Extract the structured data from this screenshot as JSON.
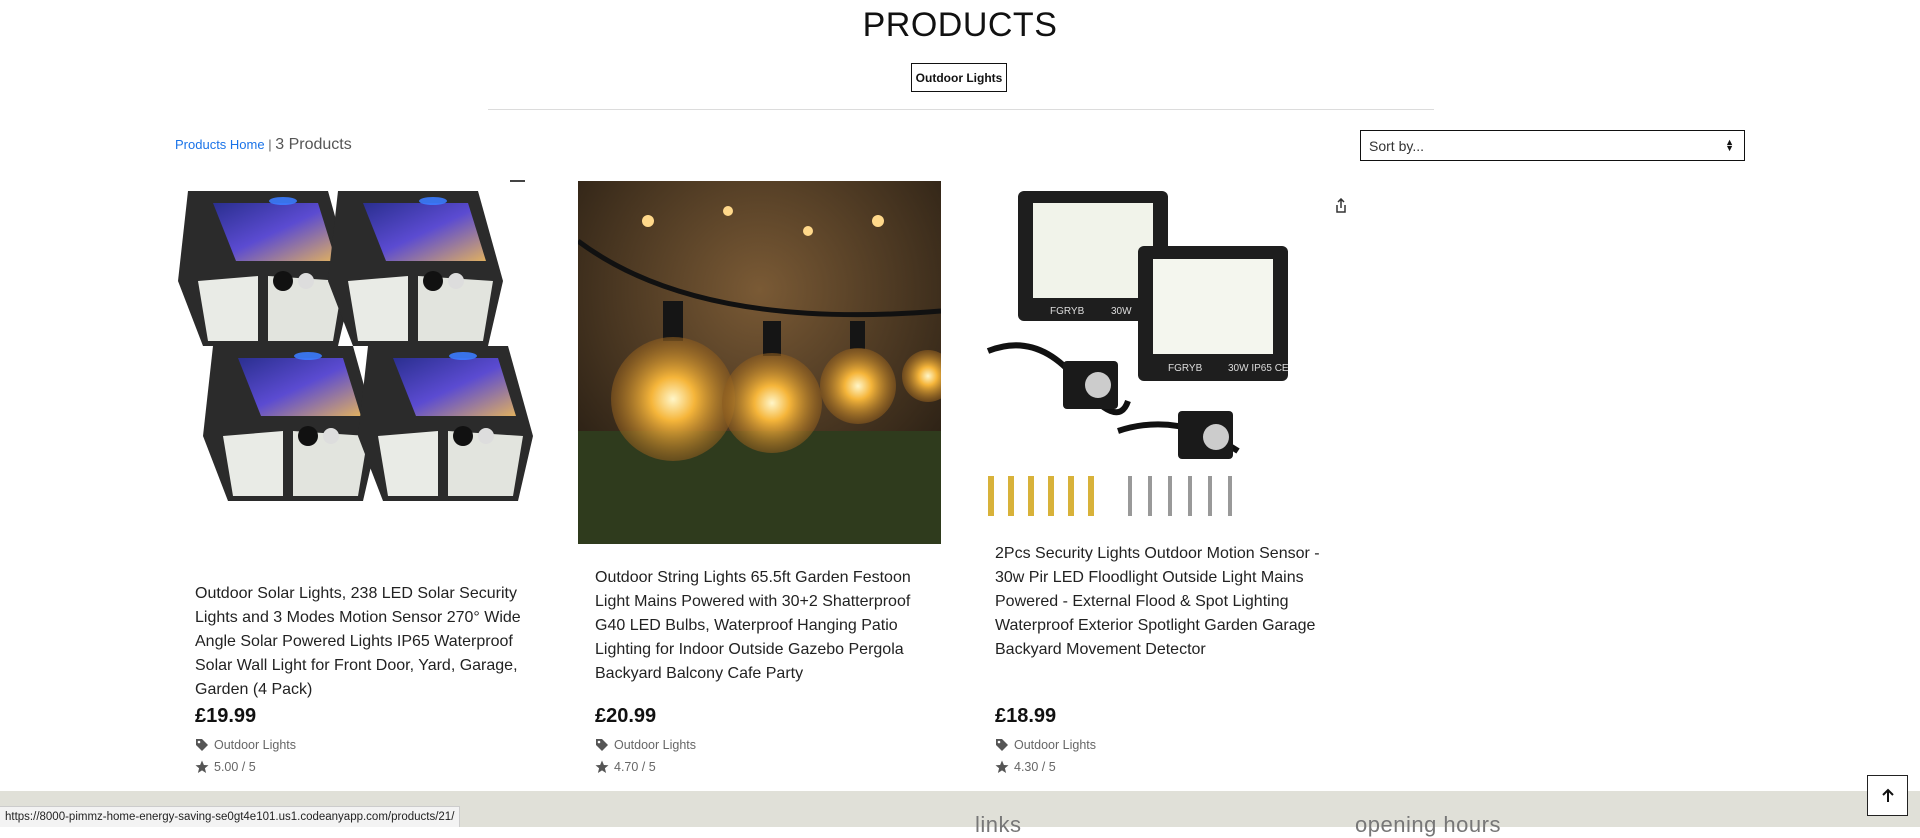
{
  "header": {
    "title": "PRODUCTS",
    "filter_label": "Outdoor Lights"
  },
  "toolbar": {
    "breadcrumb_link": "Products Home",
    "breadcrumb_sep": "|",
    "product_count": "3 Products",
    "sort_placeholder": "Sort by..."
  },
  "products": [
    {
      "title": "Outdoor Solar Lights, 238 LED Solar Security Lights and 3 Modes Motion Sensor 270° Wide Angle Solar Powered Lights IP65 Waterproof Solar Wall Light for Front Door, Yard, Garage, Garden (4 Pack)",
      "price": "£19.99",
      "category": "Outdoor Lights",
      "rating": "5.00 / 5"
    },
    {
      "title": "Outdoor String Lights 65.5ft Garden Festoon Light Mains Powered with 30+2 Shatterproof G40 LED Bulbs, Waterproof Hanging Patio Lighting for Indoor Outside Gazebo Pergola Backyard Balcony Cafe Party",
      "price": "£20.99",
      "category": "Outdoor Lights",
      "rating": "4.70 / 5"
    },
    {
      "title": "2Pcs Security Lights Outdoor Motion Sensor - 30w Pir LED Floodlight Outside Light Mains Powered - External Flood & Spot Lighting Waterproof Exterior Spotlight Garden Garage Backyard Movement Detector",
      "price": "£18.99",
      "category": "Outdoor Lights",
      "rating": "4.30 / 5",
      "image_text_brand": "FGRYB",
      "image_text_spec1": "30W",
      "image_text_spec2": "30W IP65 CE"
    }
  ],
  "footer": {
    "col1_heading": "links",
    "col2_heading": "opening hours"
  },
  "status_bar": {
    "url": "https://8000-pimmz-home-energy-saving-se0gt4e101.us1.codeanyapp.com/products/21/"
  },
  "icons": {
    "tag": "tag-icon",
    "star": "star-icon",
    "share": "share-icon",
    "back_to_top": "arrow-up-icon"
  }
}
